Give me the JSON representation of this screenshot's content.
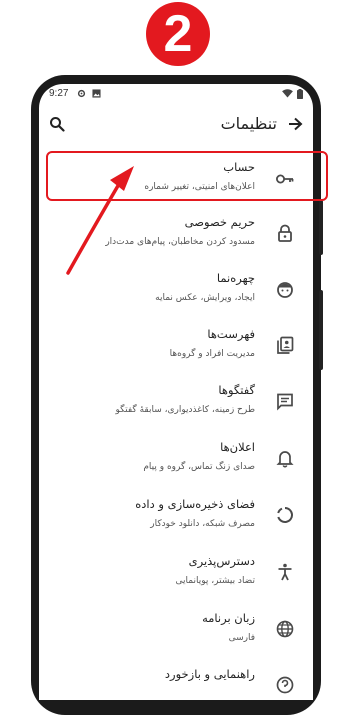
{
  "step_badge": "2",
  "status_bar": {
    "time": "9:27"
  },
  "header": {
    "title": "تنظیمات"
  },
  "settings": [
    {
      "title": "حساب",
      "subtitle": "اعلان‌های امنیتی، تغییر شماره",
      "icon": "key-icon"
    },
    {
      "title": "حریم خصوصی",
      "subtitle": "مسدود کردن مخاطبان، پیام‌های مدت‌دار",
      "icon": "lock-icon"
    },
    {
      "title": "چهره‌نما",
      "subtitle": "ایجاد، ویرایش، عکس نمایه",
      "icon": "avatar-face-icon"
    },
    {
      "title": "فهرست‌ها",
      "subtitle": "مدیریت افراد و گروه‌ها",
      "icon": "contacts-list-icon"
    },
    {
      "title": "گفتگوها",
      "subtitle": "طرح زمینه، کاغذدیواری، سابقهٔ گفتگو",
      "icon": "chat-icon"
    },
    {
      "title": "اعلان‌ها",
      "subtitle": "صدای زنگ تماس، گروه و پیام",
      "icon": "bell-icon"
    },
    {
      "title": "فضای ذخیره‌سازی و داده",
      "subtitle": "مصرف شبکه، دانلود خودکار",
      "icon": "storage-circle-icon"
    },
    {
      "title": "دسترس‌پذیری",
      "subtitle": "تضاد بیشتر، پویانمایی",
      "icon": "accessibility-icon"
    },
    {
      "title": "زبان برنامه",
      "subtitle": "فارسی",
      "icon": "globe-icon"
    },
    {
      "title": "راهنمایی و بازخورد",
      "subtitle": "",
      "icon": "help-icon"
    }
  ],
  "colors": {
    "accent_red": "#e3191f",
    "icon_gray": "#4a4a4a"
  }
}
